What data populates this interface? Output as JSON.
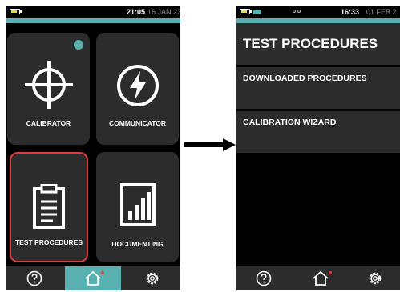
{
  "left_screen": {
    "status": {
      "time": "21:05",
      "date": "16 JAN 23"
    },
    "tiles": [
      {
        "label": "CALIBRATOR",
        "icon": "crosshair-icon"
      },
      {
        "label": "COMMUNICATOR",
        "icon": "lightning-bolt-icon"
      },
      {
        "label": "TEST PROCEDURES",
        "icon": "clipboard-icon",
        "selected": true
      },
      {
        "label": "DOCUMENTING",
        "icon": "bar-chart-icon"
      }
    ],
    "nav": [
      {
        "icon": "help-icon"
      },
      {
        "icon": "home-icon",
        "active": true
      },
      {
        "icon": "settings-gear-icon"
      }
    ]
  },
  "right_screen": {
    "status": {
      "time": "16:33",
      "date": "01 FEB 2"
    },
    "title": "TEST PROCEDURES",
    "items": [
      "DOWNLOADED PROCEDURES",
      "CALIBRATION WIZARD"
    ],
    "nav": [
      {
        "icon": "help-icon"
      },
      {
        "icon": "home-icon"
      },
      {
        "icon": "settings-gear-icon"
      }
    ]
  },
  "colors": {
    "accent": "#58b0b0",
    "tile": "#2c2c2c",
    "selection": "#e03a3a",
    "battery": "#e9e22a",
    "notification": "#e83838"
  }
}
